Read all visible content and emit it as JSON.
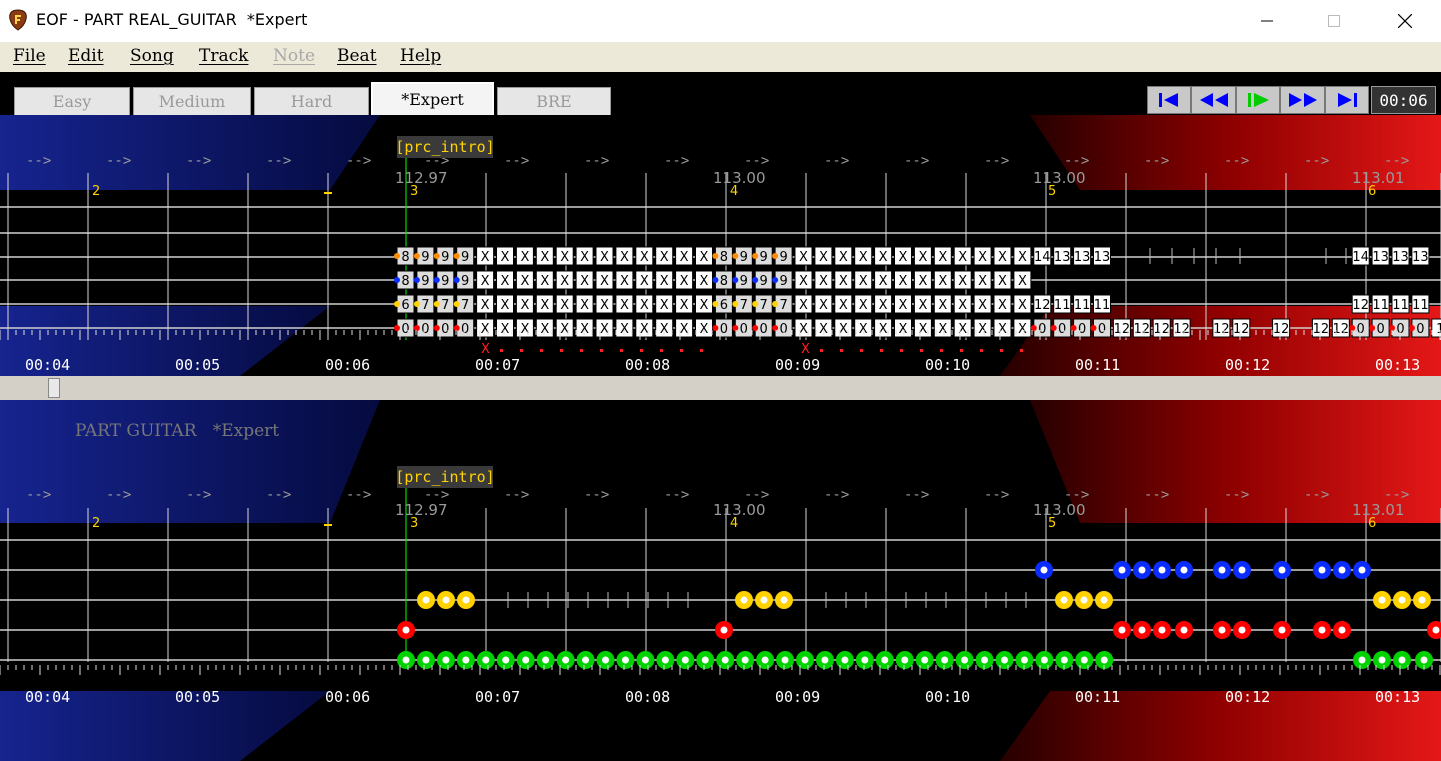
{
  "window": {
    "title": "EOF - PART REAL_GUITAR  *Expert",
    "minimize_label": "—",
    "maximize_label": "☐",
    "close_label": "✕"
  },
  "menu": [
    "File",
    "Edit",
    "Song",
    "Track",
    "Note",
    "Beat",
    "Help"
  ],
  "menu_disabled": [
    "Note"
  ],
  "tabs": [
    "Easy",
    "Medium",
    "Hard",
    "*Expert",
    "BRE"
  ],
  "active_tab": "*Expert",
  "transport": {
    "icons": [
      "skip-to-start-icon",
      "rewind-icon",
      "play-icon",
      "fast-forward-icon",
      "skip-to-end-icon"
    ],
    "clock": "00:06"
  },
  "timeline": {
    "time_labels": [
      "00:04",
      "00:05",
      "00:06",
      "00:07",
      "00:08",
      "00:09",
      "00:10",
      "00:11",
      "00:12",
      "00:13"
    ],
    "tempo_labels": [
      "112.97",
      "113.00",
      "113.00",
      "113.01"
    ],
    "measure_labels": [
      "2",
      "3",
      "4",
      "5",
      "6"
    ],
    "arrow_label": "-->",
    "section_marker": "[prc_intro]"
  },
  "upper_pane": {
    "tab_rows": [
      [
        "8",
        "9",
        "9",
        "9",
        "X",
        "X",
        "X",
        "X",
        "X",
        "X",
        "X",
        "X",
        "X",
        "X",
        "X",
        "X",
        "8",
        "9",
        "9",
        "9",
        "X",
        "X",
        "X",
        "X",
        "X",
        "X",
        "X",
        "X",
        "X",
        "X",
        "X",
        "X",
        "14",
        "13",
        "13",
        "13",
        "",
        "",
        "",
        "",
        "",
        "",
        "",
        "",
        "",
        "",
        "",
        "",
        "14",
        "13",
        "13",
        "13"
      ],
      [
        "8",
        "9",
        "9",
        "9",
        "X",
        "X",
        "X",
        "X",
        "X",
        "X",
        "X",
        "X",
        "X",
        "X",
        "X",
        "X",
        "8",
        "9",
        "9",
        "9",
        "X",
        "X",
        "X",
        "X",
        "X",
        "X",
        "X",
        "X",
        "X",
        "X",
        "X",
        "X"
      ],
      [
        "6",
        "7",
        "7",
        "7",
        "X",
        "X",
        "X",
        "X",
        "X",
        "X",
        "X",
        "X",
        "X",
        "X",
        "X",
        "X",
        "6",
        "7",
        "7",
        "7",
        "X",
        "X",
        "X",
        "X",
        "X",
        "X",
        "X",
        "X",
        "X",
        "X",
        "X",
        "X",
        "12",
        "11",
        "11",
        "11",
        "",
        "",
        "",
        "",
        "",
        "",
        "",
        "",
        "",
        "",
        "",
        "",
        "12",
        "11",
        "11",
        "11"
      ],
      [
        "0",
        "0",
        "0",
        "0",
        "X",
        "X",
        "X",
        "X",
        "X",
        "X",
        "X",
        "X",
        "X",
        "X",
        "X",
        "X",
        "0",
        "0",
        "0",
        "0",
        "X",
        "X",
        "X",
        "X",
        "X",
        "X",
        "X",
        "X",
        "X",
        "X",
        "X",
        "X",
        "0",
        "0",
        "0",
        "0",
        "12",
        "12",
        "12",
        "12",
        "",
        "12",
        "12",
        "",
        "12",
        "",
        "12",
        "12",
        "0",
        "0",
        "0",
        "0",
        "1"
      ]
    ],
    "mute_markers": [
      "X",
      "X"
    ]
  },
  "lower_pane": {
    "track_name": "PART GUITAR   *Expert",
    "lane_colors": [
      "#0000ff",
      "#ffff00",
      "#ff0000",
      "#00cc00"
    ]
  },
  "colors": {
    "yellow": "#ffd200",
    "blue": "#0a2cff",
    "red": "#ff0000",
    "green": "#00d200",
    "orange": "#ff8c00"
  }
}
